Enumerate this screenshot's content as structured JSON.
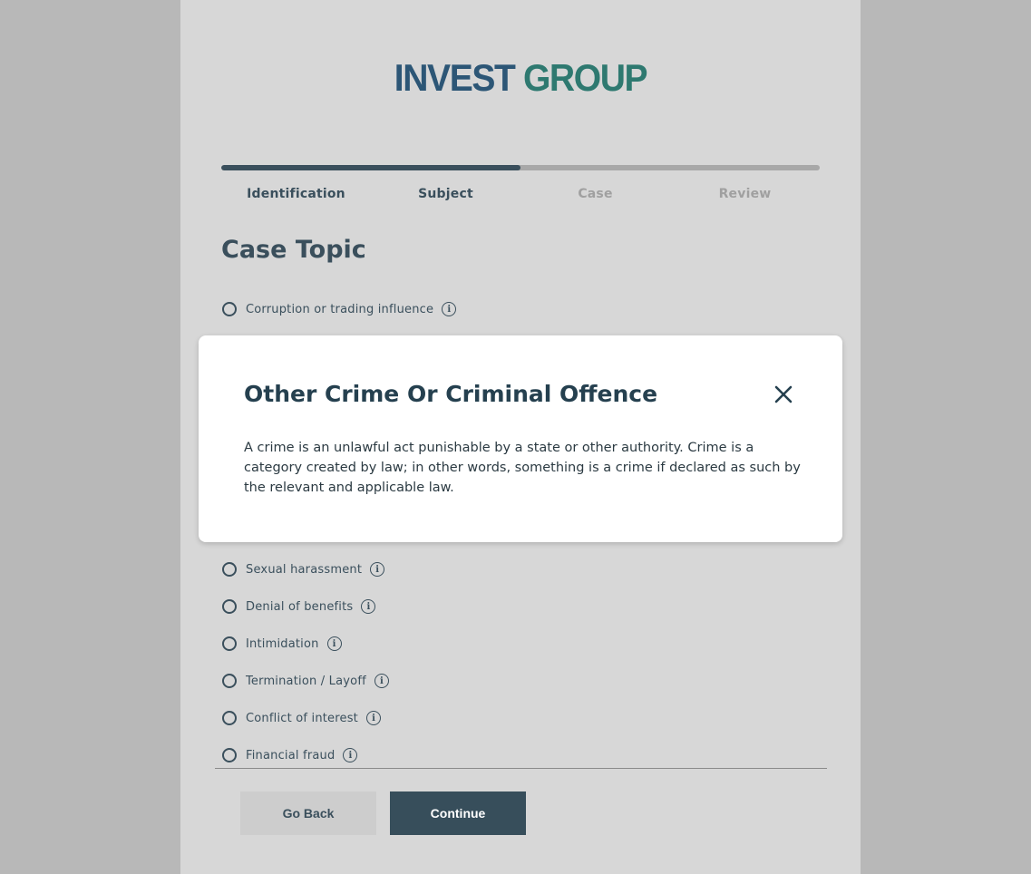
{
  "brand": {
    "word1": "INVEST",
    "word2": "GROUP"
  },
  "progress": {
    "fraction": 0.5
  },
  "steps": [
    {
      "label": "Identification",
      "state": "done"
    },
    {
      "label": "Subject",
      "state": "done"
    },
    {
      "label": "Case",
      "state": "todo"
    },
    {
      "label": "Review",
      "state": "todo"
    }
  ],
  "section": {
    "title": "Case Topic"
  },
  "options": [
    {
      "label": "Corruption or trading influence"
    },
    {
      "label": "Sexual harassment"
    },
    {
      "label": "Denial of benefits"
    },
    {
      "label": "Intimidation"
    },
    {
      "label": "Termination / Layoff"
    },
    {
      "label": "Conflict of interest"
    },
    {
      "label": "Financial fraud"
    }
  ],
  "buttons": {
    "back": "Go Back",
    "continue": "Continue"
  },
  "modal": {
    "title": "Other Crime Or Criminal Offence",
    "body": "A crime is an unlawful act punishable by a state or other authority. Crime is a category created by law; in other words, something is a crime if declared as such by the relevant and applicable law."
  },
  "colors": {
    "brand_blue": "#2c5676",
    "brand_green": "#2e7970",
    "primary": "#374e5b"
  },
  "icons": {
    "info": "info-icon",
    "close": "close-icon",
    "radio": "radio-icon"
  }
}
